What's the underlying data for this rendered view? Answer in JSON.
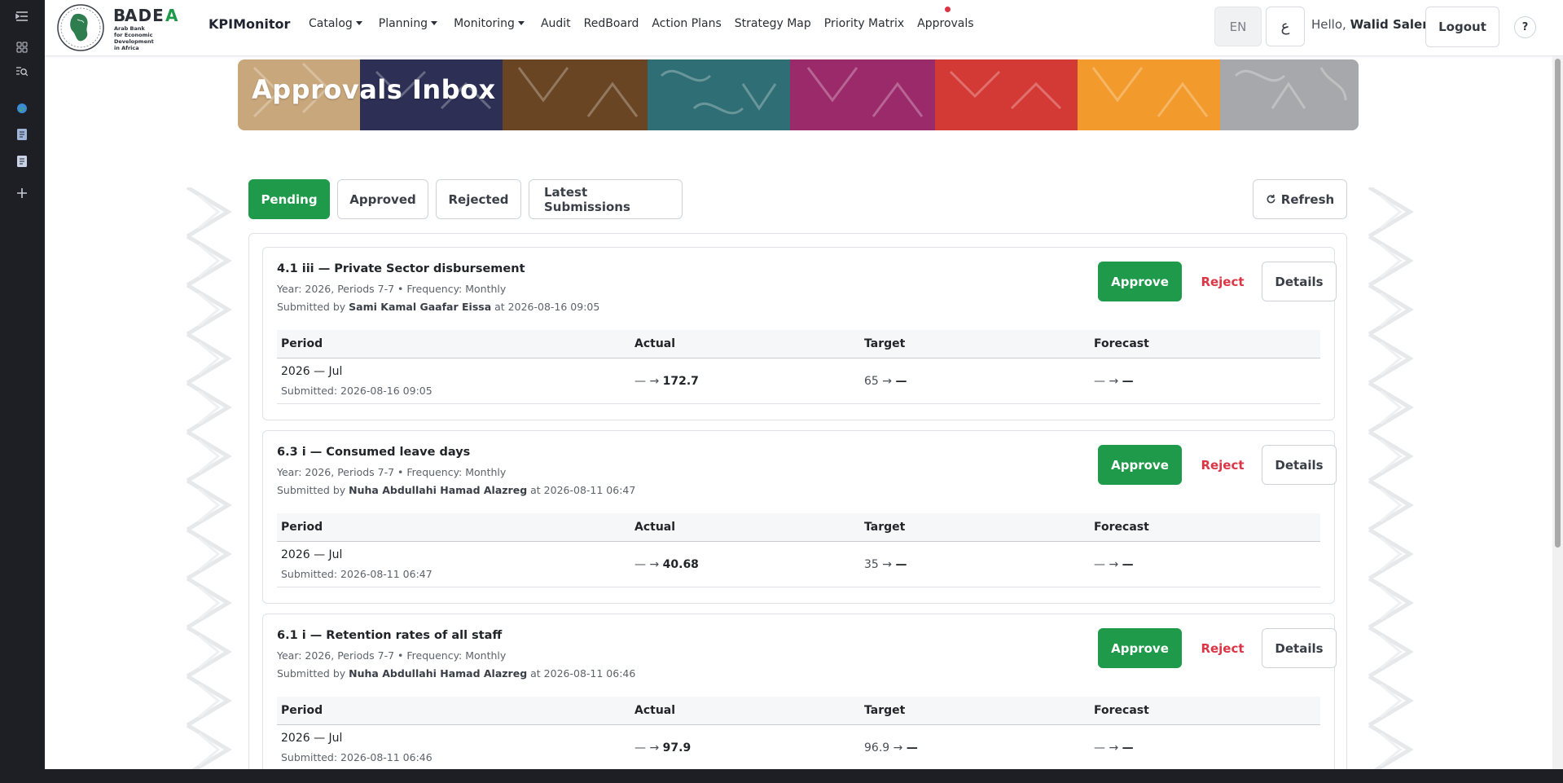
{
  "rail": {
    "icons": [
      "collapse-menu-icon",
      "apps-grid-icon",
      "search-panel-icon",
      "globe-icon",
      "notes-icon",
      "pages-icon",
      "add-icon"
    ]
  },
  "nav": {
    "brand": "KPIMonitor",
    "items": [
      {
        "label": "Catalog",
        "dropdown": true
      },
      {
        "label": "Planning",
        "dropdown": true
      },
      {
        "label": "Monitoring",
        "dropdown": true
      },
      {
        "label": "Audit",
        "dropdown": false
      },
      {
        "label": "RedBoard",
        "dropdown": false
      },
      {
        "label": "Action Plans",
        "dropdown": false
      },
      {
        "label": "Strategy Map",
        "dropdown": false
      },
      {
        "label": "Priority Matrix",
        "dropdown": false
      },
      {
        "label": "Approvals",
        "dropdown": false
      }
    ],
    "lang": "EN",
    "lang_alt": "ع",
    "hello_prefix": "Hello,",
    "user_name": "Walid Salem",
    "logout": "Logout",
    "help": "?"
  },
  "logo": {
    "name": "BADEA",
    "subtitle_lines": [
      "Arab Bank",
      "for Economic",
      "Development",
      "in Africa"
    ]
  },
  "banner": {
    "title": "Approvals Inbox"
  },
  "tabs": [
    {
      "label": "Pending",
      "active": true
    },
    {
      "label": "Approved",
      "active": false
    },
    {
      "label": "Rejected",
      "active": false
    },
    {
      "label": "Latest Submissions",
      "active": false
    }
  ],
  "refresh_label": "Refresh",
  "table_headers": {
    "period": "Period",
    "actual": "Actual",
    "target": "Target",
    "forecast": "Forecast"
  },
  "actions": {
    "approve": "Approve",
    "reject": "Reject",
    "details": "Details"
  },
  "items": [
    {
      "title": "4.1 iii — Private Sector disbursement",
      "meta": "Year: 2026, Periods 7-7 • Frequency: Monthly",
      "submitted_by_prefix": "Submitted by",
      "submitter": "Sami Kamal Gaafar Eissa",
      "submitted_at": "at 2026-08-16 09:05",
      "period": "2026 — Jul",
      "period_submitted": "Submitted: 2026-08-16 09:05",
      "actual_old": "—",
      "actual_new": "172.7",
      "target_old": "65",
      "target_new": "—",
      "forecast_old": "—",
      "forecast_new": "—"
    },
    {
      "title": "6.3 i — Consumed leave days",
      "meta": "Year: 2026, Periods 7-7 • Frequency: Monthly",
      "submitted_by_prefix": "Submitted by",
      "submitter": "Nuha Abdullahi Hamad Alazreg",
      "submitted_at": "at 2026-08-11 06:47",
      "period": "2026 — Jul",
      "period_submitted": "Submitted: 2026-08-11 06:47",
      "actual_old": "—",
      "actual_new": "40.68",
      "target_old": "35",
      "target_new": "—",
      "forecast_old": "—",
      "forecast_new": "—"
    },
    {
      "title": "6.1 i — Retention rates of all staff",
      "meta": "Year: 2026, Periods 7-7 • Frequency: Monthly",
      "submitted_by_prefix": "Submitted by",
      "submitter": "Nuha Abdullahi Hamad Alazreg",
      "submitted_at": "at 2026-08-11 06:46",
      "period": "2026 — Jul",
      "period_submitted": "Submitted: 2026-08-11 06:46",
      "actual_old": "—",
      "actual_new": "97.9",
      "target_old": "96.9",
      "target_new": "—",
      "forecast_old": "—",
      "forecast_new": "—"
    }
  ],
  "colors": {
    "primary_green": "#1e9a4a",
    "reject_red": "#dc3545",
    "notification_dot": "#dc3545"
  }
}
